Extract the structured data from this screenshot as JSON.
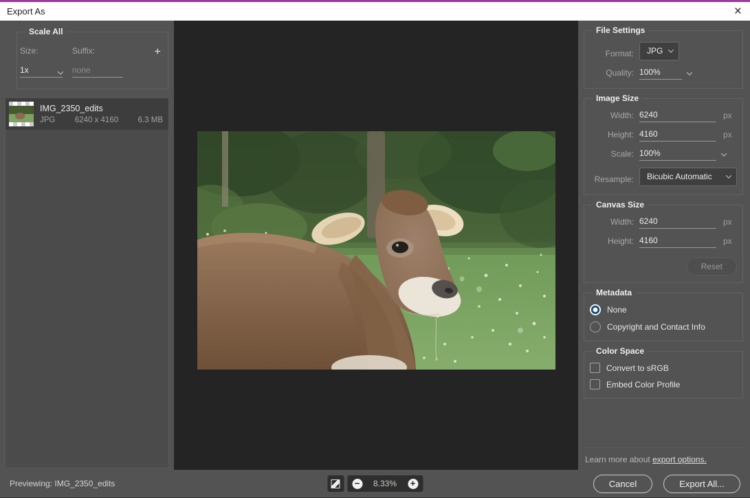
{
  "titlebar": {
    "title": "Export As",
    "close": "×"
  },
  "scale_all": {
    "title": "Scale All",
    "size_label": "Size:",
    "size_value": "1x",
    "suffix_label": "Suffix:",
    "suffix_placeholder": "none",
    "add_label": "+"
  },
  "file_item": {
    "name": "IMG_2350_edits",
    "format": "JPG",
    "dimensions": "6240 x 4160",
    "size": "6.3 MB"
  },
  "file_settings": {
    "title": "File Settings",
    "format_label": "Format:",
    "format_value": "JPG",
    "quality_label": "Quality:",
    "quality_value": "100%"
  },
  "image_size": {
    "title": "Image Size",
    "width_label": "Width:",
    "width_value": "6240",
    "width_unit": "px",
    "height_label": "Height:",
    "height_value": "4160",
    "height_unit": "px",
    "scale_label": "Scale:",
    "scale_value": "100%",
    "resample_label": "Resample:",
    "resample_value": "Bicubic Automatic"
  },
  "canvas_size": {
    "title": "Canvas Size",
    "width_label": "Width:",
    "width_value": "6240",
    "width_unit": "px",
    "height_label": "Height:",
    "height_value": "4160",
    "height_unit": "px",
    "reset_label": "Reset"
  },
  "metadata": {
    "title": "Metadata",
    "options": [
      {
        "label": "None",
        "selected": true
      },
      {
        "label": "Copyright and Contact Info",
        "selected": false
      }
    ]
  },
  "color_space": {
    "title": "Color Space",
    "options": [
      {
        "label": "Convert to sRGB",
        "checked": false
      },
      {
        "label": "Embed Color Profile",
        "checked": false
      }
    ]
  },
  "footer_link": {
    "prefix": "Learn more about ",
    "link": "export options."
  },
  "bottom_bar": {
    "previewing": "Previewing: IMG_2350_edits",
    "zoom_out": "−",
    "zoom_value": "8.33%",
    "zoom_in": "+",
    "cancel_label": "Cancel",
    "export_label": "Export All..."
  },
  "colors": {
    "titlebar_accent": "#9c3a9e",
    "panel_bg": "#535353",
    "preview_bg": "#242424",
    "selected_item_bg": "#3d3d3d",
    "radio_selected": "#1c4f81"
  }
}
